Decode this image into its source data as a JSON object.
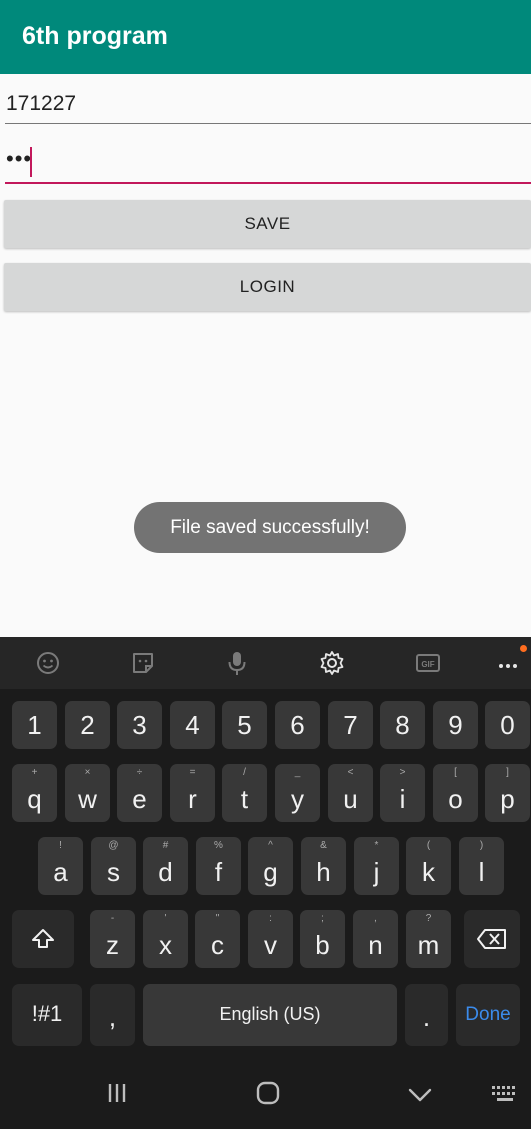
{
  "app": {
    "title": "6th program"
  },
  "form": {
    "username_value": "171227",
    "password_value": "•••",
    "save_label": "SAVE",
    "login_label": "LOGIN"
  },
  "toast": {
    "message": "File saved successfully!"
  },
  "keyboard": {
    "toolbar_icons": [
      "emoji-icon",
      "sticker-icon",
      "microphone-icon",
      "gear-icon",
      "gif-icon",
      "more-icon"
    ],
    "number_row": [
      "1",
      "2",
      "3",
      "4",
      "5",
      "6",
      "7",
      "8",
      "9",
      "0"
    ],
    "row1": [
      {
        "key": "q",
        "sub": "+"
      },
      {
        "key": "w",
        "sub": "×"
      },
      {
        "key": "e",
        "sub": "÷"
      },
      {
        "key": "r",
        "sub": "="
      },
      {
        "key": "t",
        "sub": "/"
      },
      {
        "key": "y",
        "sub": "_"
      },
      {
        "key": "u",
        "sub": "<"
      },
      {
        "key": "i",
        "sub": ">"
      },
      {
        "key": "o",
        "sub": "["
      },
      {
        "key": "p",
        "sub": "]"
      }
    ],
    "row2": [
      {
        "key": "a",
        "sub": "!"
      },
      {
        "key": "s",
        "sub": "@"
      },
      {
        "key": "d",
        "sub": "#"
      },
      {
        "key": "f",
        "sub": "%"
      },
      {
        "key": "g",
        "sub": "^"
      },
      {
        "key": "h",
        "sub": "&"
      },
      {
        "key": "j",
        "sub": "*"
      },
      {
        "key": "k",
        "sub": "("
      },
      {
        "key": "l",
        "sub": ")"
      }
    ],
    "row3": [
      {
        "key": "z",
        "sub": "-"
      },
      {
        "key": "x",
        "sub": "'"
      },
      {
        "key": "c",
        "sub": "\""
      },
      {
        "key": "v",
        "sub": ":"
      },
      {
        "key": "b",
        "sub": ";"
      },
      {
        "key": "n",
        "sub": ","
      },
      {
        "key": "m",
        "sub": "?"
      }
    ],
    "symbols_label": "!#1",
    "comma_label": ",",
    "space_label": "English (US)",
    "period_label": ".",
    "done_label": "Done"
  },
  "colors": {
    "appbar": "#00897b",
    "accent": "#c2185b",
    "done_text": "#3b8beb"
  }
}
